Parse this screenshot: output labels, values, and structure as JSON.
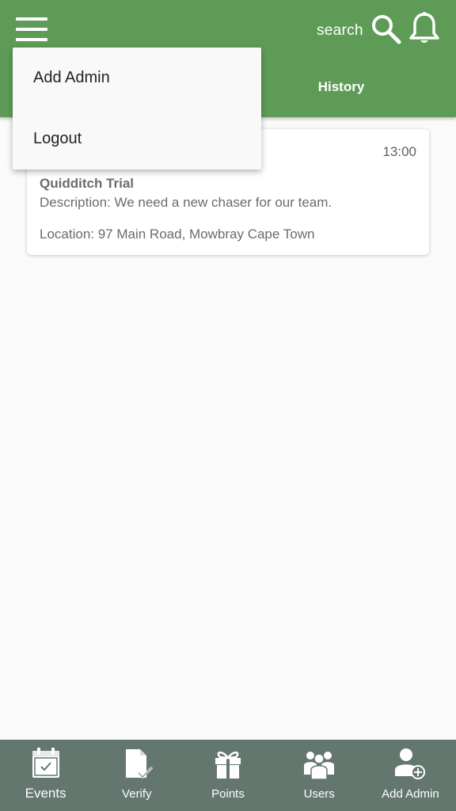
{
  "header": {
    "search_label": "search",
    "tabs": [
      {
        "label": "History"
      }
    ],
    "color": "#5e9b57"
  },
  "dropdown": {
    "items": [
      {
        "label": "Add Admin"
      },
      {
        "label": "Logout"
      }
    ]
  },
  "events": [
    {
      "time": "13:00",
      "title": "Quidditch Trial",
      "description": "Description: We need a new chaser for our team.",
      "location": "Location: 97 Main Road, Mowbray Cape Town"
    }
  ],
  "bottom_nav": {
    "color": "#64776f",
    "items": [
      {
        "label": "Events",
        "icon": "calendar-check-icon",
        "active": true
      },
      {
        "label": "Verify",
        "icon": "document-check-icon"
      },
      {
        "label": "Points",
        "icon": "gift-icon"
      },
      {
        "label": "Users",
        "icon": "users-icon"
      },
      {
        "label": "Add Admin",
        "icon": "add-user-icon"
      }
    ]
  }
}
